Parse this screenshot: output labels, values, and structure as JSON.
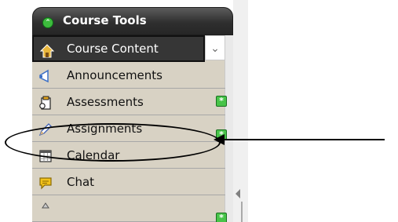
{
  "panel": {
    "title": "Course Tools",
    "items": [
      {
        "label": "Course Content",
        "icon": "home-icon",
        "selected": true
      },
      {
        "label": "Announcements",
        "icon": "megaphone-icon"
      },
      {
        "label": "Assessments",
        "icon": "clipboard-icon",
        "badge": true
      },
      {
        "label": "Assignments",
        "icon": "pencil-icon",
        "badge": true
      },
      {
        "label": "Calendar",
        "icon": "calendar-icon"
      },
      {
        "label": "Chat",
        "icon": "speech-bubble-icon"
      }
    ]
  },
  "colors": {
    "header": "#2f2f2f",
    "list_bg": "#d8d2c4",
    "selected_bg": "#363636",
    "badge": "#48c449",
    "annotation": "#000000"
  }
}
